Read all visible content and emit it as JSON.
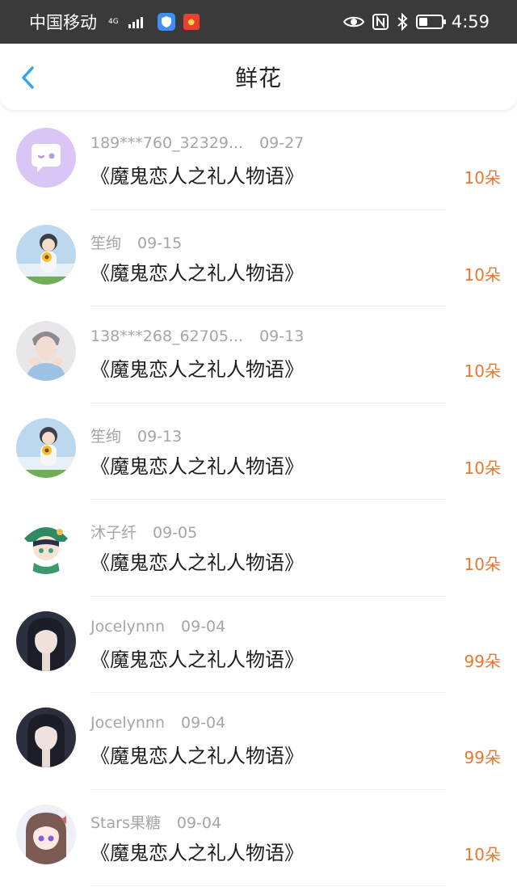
{
  "status_bar": {
    "carrier": "中国移动",
    "network": "4G",
    "time": "4:59"
  },
  "header": {
    "title": "鲜花"
  },
  "records": [
    {
      "user": "189***760_32329...",
      "date": "09-27",
      "book": "《魔鬼恋人之礼人物语》",
      "amount": "10朵",
      "avatar": "chat-bubble-avatar"
    },
    {
      "user": "笙绚",
      "date": "09-15",
      "book": "《魔鬼恋人之礼人物语》",
      "amount": "10朵",
      "avatar": "anime-boy-sunflower-avatar"
    },
    {
      "user": "138***268_62705...",
      "date": "09-13",
      "book": "《魔鬼恋人之礼人物语》",
      "amount": "10朵",
      "avatar": "photo-person-avatar"
    },
    {
      "user": "笙绚",
      "date": "09-13",
      "book": "《魔鬼恋人之礼人物语》",
      "amount": "10朵",
      "avatar": "anime-boy-sunflower-avatar"
    },
    {
      "user": "沐子纤",
      "date": "09-05",
      "book": "《魔鬼恋人之礼人物语》",
      "amount": "10朵",
      "avatar": "anime-green-hat-avatar"
    },
    {
      "user": "Jocelynnn",
      "date": "09-04",
      "book": "《魔鬼恋人之礼人物语》",
      "amount": "99朵",
      "avatar": "photo-girl-avatar"
    },
    {
      "user": "Jocelynnn",
      "date": "09-04",
      "book": "《魔鬼恋人之礼人物语》",
      "amount": "99朵",
      "avatar": "photo-girl-avatar"
    },
    {
      "user": "Stars果糖",
      "date": "09-04",
      "book": "《魔鬼恋人之礼人物语》",
      "amount": "10朵",
      "avatar": "anime-girl-avatar"
    }
  ],
  "colors": {
    "accent": "#3aa0f0",
    "amount": "#e8772e",
    "status_bar": "#3a3a3a"
  }
}
